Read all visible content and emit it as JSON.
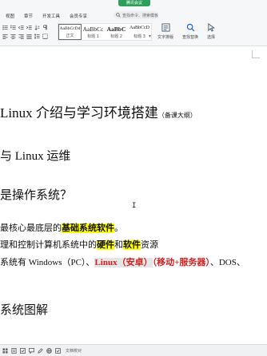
{
  "ribbon": {
    "meeting_label": "腾讯会议",
    "menu": [
      {
        "label": "视图"
      },
      {
        "label": "章节"
      },
      {
        "label": "开发工具"
      },
      {
        "label": "会员专享"
      }
    ],
    "search_placeholder": "查找命令、搜索模板",
    "styles": [
      {
        "sample": "AaBbCcDd",
        "label": "正文"
      },
      {
        "sample": "AaBbCc",
        "label": "标题 1"
      },
      {
        "sample": "AaBbC",
        "label": "标题 2"
      },
      {
        "sample": "AaBbCcD",
        "label": "标题 3"
      }
    ],
    "text_tools_label": "文字排版",
    "find_replace_label": "查找替换",
    "select_label": "选择"
  },
  "document": {
    "h1_text": "Linux 介绍与学习环境搭建",
    "h1_note": "（备课大纲）",
    "h2_a": "与 Linux 运维",
    "h2_b": "是操作系统？",
    "line1": {
      "p1": "最核心最底层的",
      "hl": "基础系统软件",
      "p2": "。"
    },
    "line2": {
      "p1": "理和控制计算机系统中的",
      "hl1": "硬件",
      "mid": "和",
      "hl2": "软件",
      "p2": "资源"
    },
    "line3": {
      "p1": "系统有 Windows（PC）、",
      "red1": "Linux（安卓）",
      "red2": "（移动+服务器）",
      "p2": "、DOS、"
    },
    "h2_c": "系统图解",
    "cursor": "I"
  },
  "status": {
    "doc_check": "文档校对"
  },
  "colors": {
    "highlight": "#ffff00",
    "red_text": "#d22020",
    "accent": "#1d63d6"
  }
}
